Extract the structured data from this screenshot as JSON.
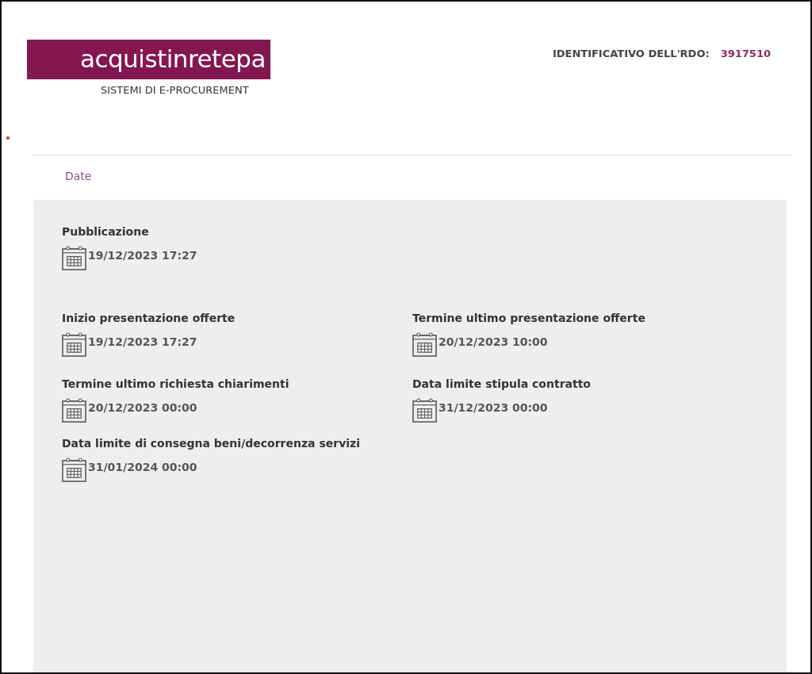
{
  "header": {
    "logo": "acquistinretepa",
    "tagline": "SISTEMI DI E-PROCUREMENT",
    "id_label": "IDENTIFICATIVO DELL'RDO:",
    "id_value": "3917510"
  },
  "section": {
    "title": "Date"
  },
  "rows": [
    {
      "items": [
        {
          "label": "Pubblicazione",
          "value": "19/12/2023 17:27"
        }
      ]
    },
    {
      "items": [
        {
          "label": "Inizio presentazione offerte",
          "value": "19/12/2023 17:27"
        },
        {
          "label": "Termine ultimo presentazione offerte",
          "value": "20/12/2023 10:00"
        }
      ]
    },
    {
      "items": [
        {
          "label": "Termine ultimo richiesta chiarimenti",
          "value": "20/12/2023 00:00"
        },
        {
          "label": "Data limite stipula contratto",
          "value": "31/12/2023 00:00"
        }
      ]
    },
    {
      "items": [
        {
          "label": "Data limite di consegna beni/decorrenza servizi",
          "value": "31/01/2024 00:00"
        }
      ]
    }
  ]
}
